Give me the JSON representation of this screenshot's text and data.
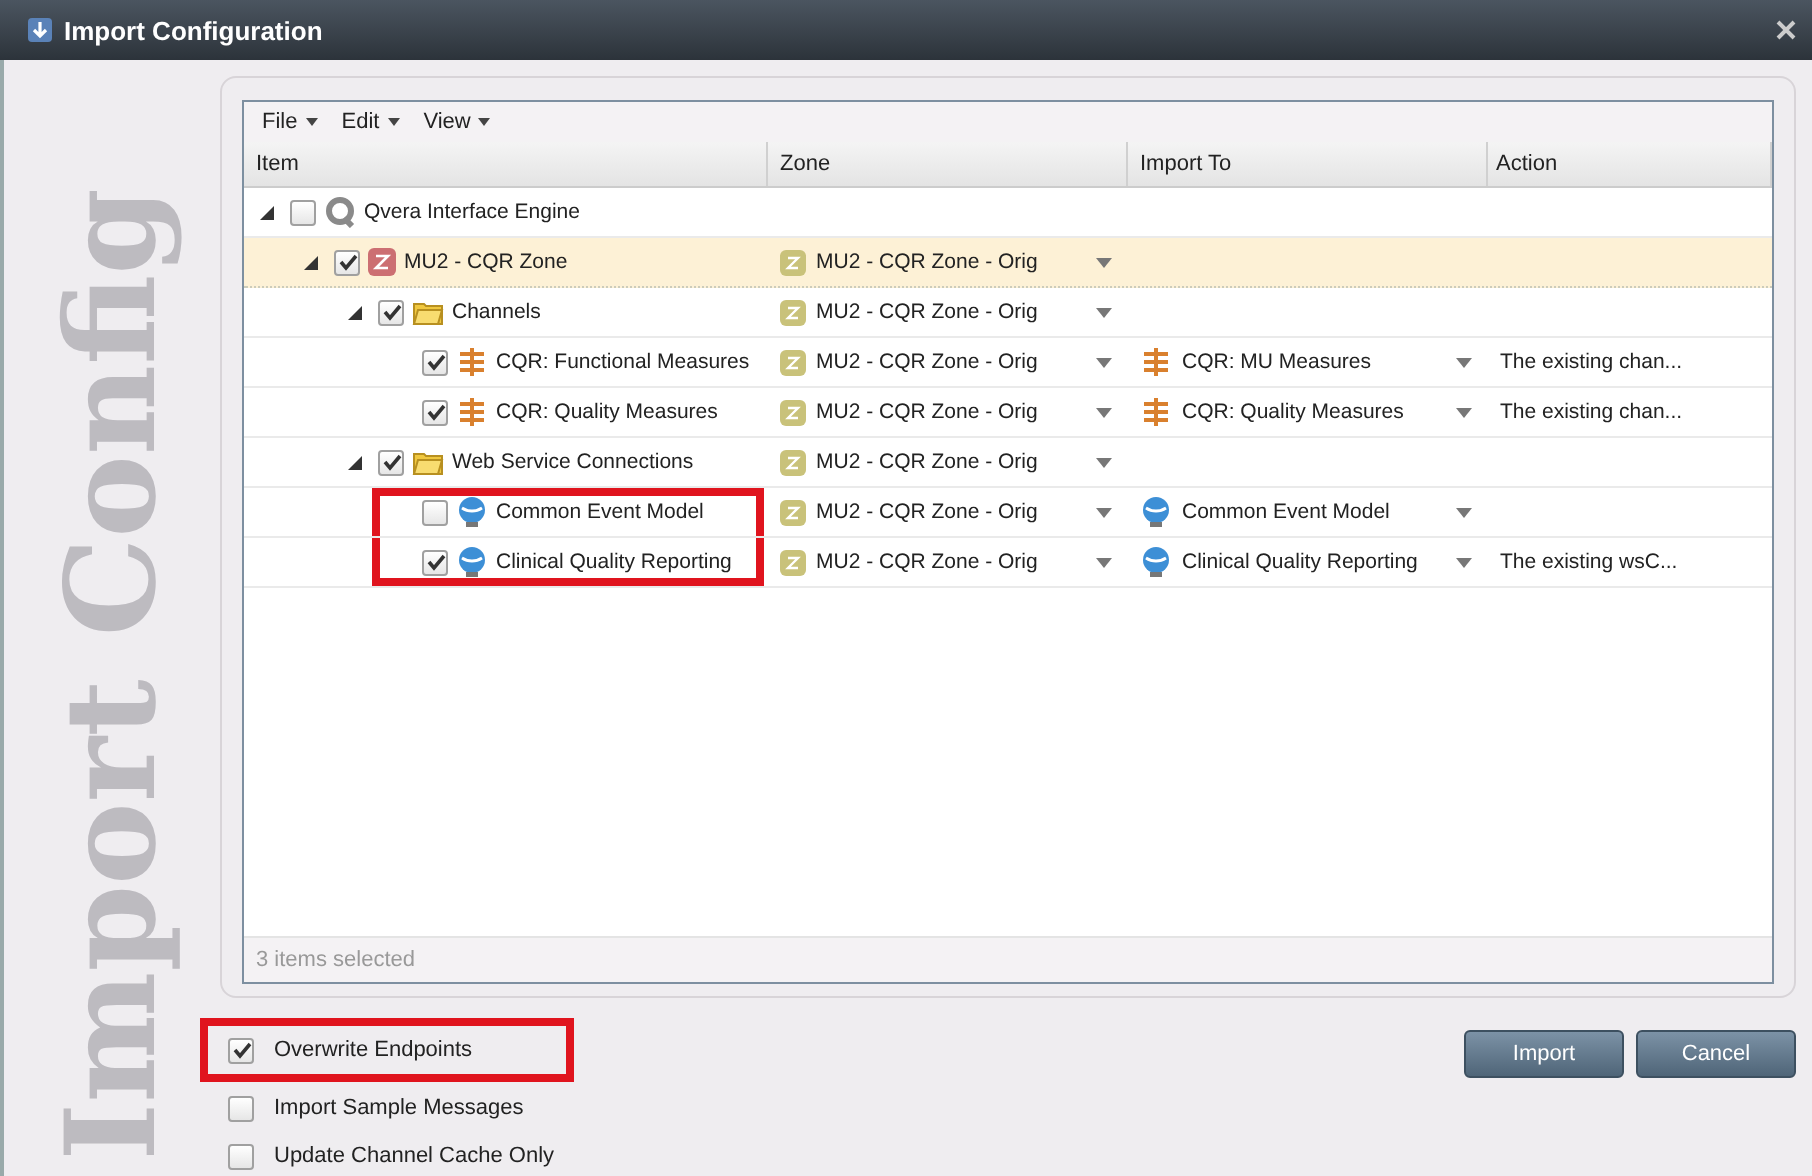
{
  "window": {
    "title": "Import Configuration"
  },
  "side_label": "Import Config",
  "menu": [
    {
      "label": "File"
    },
    {
      "label": "Edit"
    },
    {
      "label": "View"
    }
  ],
  "table": {
    "columns": [
      "Item",
      "Zone",
      "Import To",
      "Action"
    ],
    "rows": [
      {
        "name": "Qvera Interface Engine",
        "kind": "engine",
        "checked": false,
        "expanded": true,
        "selected": false,
        "children": [
          {
            "name": "MU2 - CQR Zone",
            "kind": "zone",
            "checked": true,
            "expanded": true,
            "selected": true,
            "zone": "MU2 - CQR Zone - Orig",
            "children": [
              {
                "name": "Channels",
                "kind": "folder",
                "checked": true,
                "expanded": true,
                "selected": false,
                "zone": "MU2 - CQR Zone - Orig",
                "children": [
                  {
                    "name": "CQR: Functional Measures",
                    "kind": "channel",
                    "checked": true,
                    "selected": false,
                    "zone": "MU2 - CQR Zone - Orig",
                    "import_to": {
                      "kind": "channel",
                      "label": "CQR: MU Measures"
                    },
                    "action": "The existing chan..."
                  },
                  {
                    "name": "CQR: Quality Measures",
                    "kind": "channel",
                    "checked": true,
                    "selected": false,
                    "zone": "MU2 - CQR Zone - Orig",
                    "import_to": {
                      "kind": "channel",
                      "label": "CQR: Quality Measures"
                    },
                    "action": "The existing chan..."
                  }
                ]
              },
              {
                "name": "Web Service Connections",
                "kind": "folder",
                "checked": true,
                "expanded": true,
                "selected": false,
                "zone": "MU2 - CQR Zone - Orig",
                "children": [
                  {
                    "name": "Common Event Model",
                    "kind": "service",
                    "checked": false,
                    "selected": false,
                    "highlighted": true,
                    "zone": "MU2 - CQR Zone - Orig",
                    "import_to": {
                      "kind": "service",
                      "label": "Common Event Model"
                    }
                  },
                  {
                    "name": "Clinical Quality Reporting",
                    "kind": "service",
                    "checked": true,
                    "selected": false,
                    "highlighted": true,
                    "zone": "MU2 - CQR Zone - Orig",
                    "import_to": {
                      "kind": "service",
                      "label": "Clinical Quality Reporting"
                    },
                    "action": "The existing wsC..."
                  }
                ]
              }
            ]
          }
        ]
      }
    ]
  },
  "status": "3 items selected",
  "options": [
    {
      "label": "Overwrite Endpoints",
      "checked": true,
      "highlighted": true
    },
    {
      "label": "Import Sample Messages",
      "checked": false
    },
    {
      "label": "Update Channel Cache Only",
      "checked": false
    }
  ],
  "buttons": [
    "Import",
    "Cancel"
  ]
}
